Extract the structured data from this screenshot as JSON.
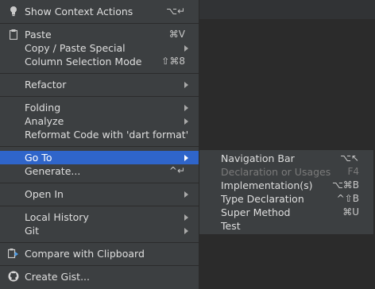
{
  "context_menu": {
    "items": [
      {
        "name": "show-context-actions",
        "icon": "lightbulb-icon",
        "label": "Show Context Actions",
        "shortcut": "⌥↵"
      },
      {
        "name": "paste",
        "icon": "clipboard-icon",
        "label": "Paste",
        "shortcut": "⌘V"
      },
      {
        "name": "copy-paste-special",
        "label": "Copy / Paste Special",
        "submenu": true
      },
      {
        "name": "column-selection-mode",
        "label": "Column Selection Mode",
        "shortcut": "⇧⌘8"
      },
      {
        "name": "refactor",
        "label": "Refactor",
        "submenu": true
      },
      {
        "name": "folding",
        "label": "Folding",
        "submenu": true
      },
      {
        "name": "analyze",
        "label": "Analyze",
        "submenu": true
      },
      {
        "name": "reformat-dart",
        "label": "Reformat Code with 'dart format'"
      },
      {
        "name": "go-to",
        "label": "Go To",
        "submenu": true,
        "selected": true
      },
      {
        "name": "generate",
        "label": "Generate...",
        "shortcut": "^↵"
      },
      {
        "name": "open-in",
        "label": "Open In",
        "submenu": true
      },
      {
        "name": "local-history",
        "label": "Local History",
        "submenu": true
      },
      {
        "name": "git",
        "label": "Git",
        "submenu": true
      },
      {
        "name": "compare-clipboard",
        "icon": "compare-icon",
        "label": "Compare with Clipboard"
      },
      {
        "name": "create-gist",
        "icon": "github-icon",
        "label": "Create Gist..."
      }
    ]
  },
  "goto_submenu": {
    "items": [
      {
        "name": "navigation-bar",
        "label": "Navigation Bar",
        "shortcut": "⌥↖"
      },
      {
        "name": "declaration-usages",
        "label": "Declaration or Usages",
        "shortcut": "F4",
        "disabled": true
      },
      {
        "name": "implementations",
        "label": "Implementation(s)",
        "shortcut": "⌥⌘B"
      },
      {
        "name": "type-declaration",
        "label": "Type Declaration",
        "shortcut": "^⇧B"
      },
      {
        "name": "super-method",
        "label": "Super Method",
        "shortcut": "⌘U"
      },
      {
        "name": "test",
        "label": "Test"
      }
    ]
  },
  "colors": {
    "menu_bg": "#3c3f41",
    "selection": "#2f65ca",
    "editor_bg": "#2b2b2b",
    "text": "#dfdfdf",
    "disabled_text": "#7a7a7a"
  }
}
